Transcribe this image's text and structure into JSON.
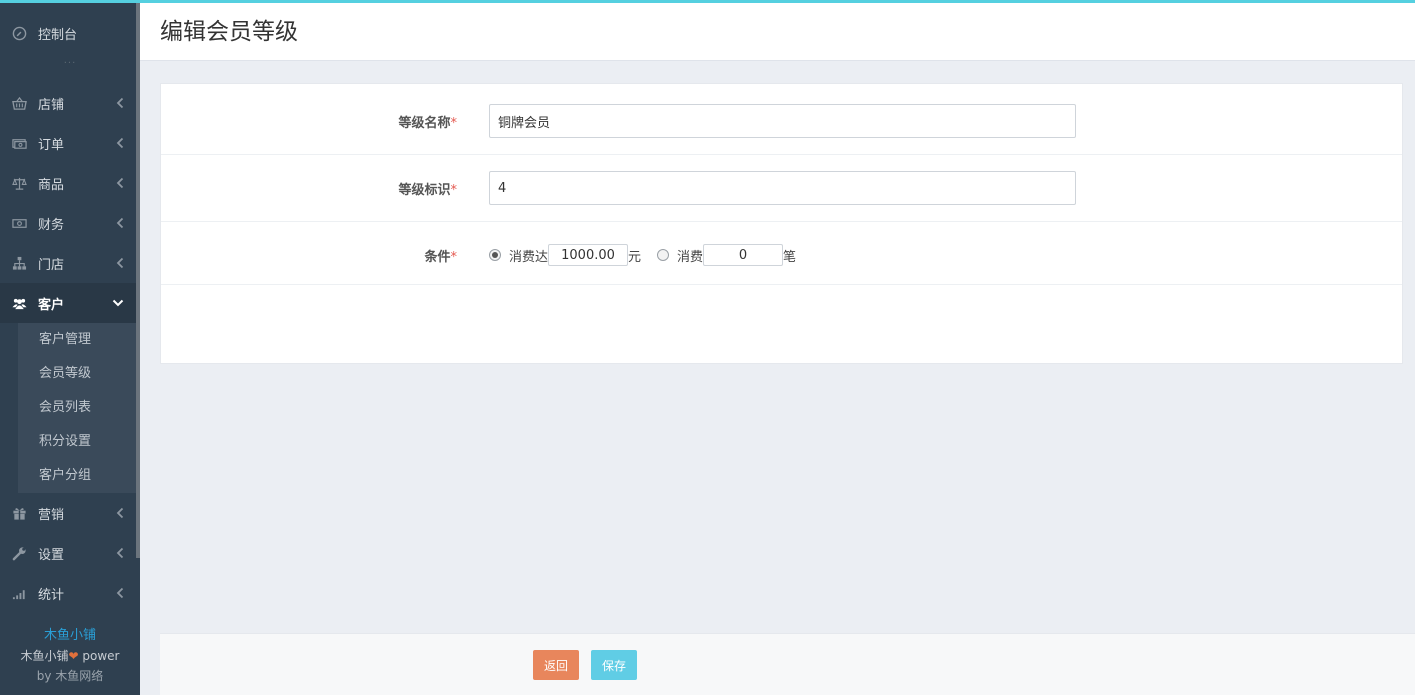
{
  "page_title": "编辑会员等级",
  "sidebar": {
    "dashboard": "控制台",
    "dots": "···",
    "items": [
      {
        "label": "店铺",
        "icon": "basket-icon"
      },
      {
        "label": "订单",
        "icon": "money-icon"
      },
      {
        "label": "商品",
        "icon": "scale-icon"
      },
      {
        "label": "财务",
        "icon": "cash-icon"
      },
      {
        "label": "门店",
        "icon": "sitemap-icon"
      },
      {
        "label": "客户",
        "icon": "users-icon",
        "active": true
      },
      {
        "label": "营销",
        "icon": "gift-icon"
      },
      {
        "label": "设置",
        "icon": "wrench-icon"
      },
      {
        "label": "统计",
        "icon": "signal-icon"
      }
    ],
    "submenu": [
      "客户管理",
      "会员等级",
      "会员列表",
      "积分设置",
      "客户分组"
    ],
    "brand_name": "木鱼小铺",
    "brand_power_pre": "木鱼小铺",
    "brand_power_post": " power",
    "brand_by": "by 木鱼网络"
  },
  "form": {
    "name_label": "等级名称",
    "name_value": "铜牌会员",
    "id_label": "等级标识",
    "id_value": "4",
    "cond_label": "条件",
    "req_mark": "*",
    "cond_amount_prefix": "消费达",
    "cond_amount_value": "1000.00",
    "cond_amount_unit": "元",
    "cond_count_prefix": "消费",
    "cond_count_value": "0",
    "cond_count_unit": "笔",
    "selected_condition": "amount"
  },
  "footer": {
    "back_label": "返回",
    "save_label": "保存"
  },
  "colors": {
    "accent": "#55d0e0",
    "sidebar_bg": "#2f4050",
    "back_button": "#e8865c",
    "save_button": "#60cde5",
    "required": "#e4584f",
    "brand": "#2a9fd6"
  }
}
